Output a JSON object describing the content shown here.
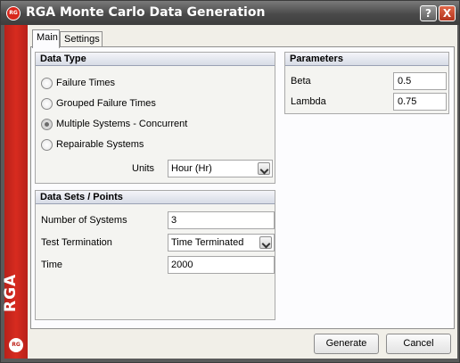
{
  "window": {
    "title": "RGA Monte Carlo Data Generation",
    "logo_text": "RG",
    "help_label": "?",
    "close_label": "X"
  },
  "sidebar": {
    "brand": "RGA",
    "logo_text": "RG"
  },
  "tabs": [
    {
      "label": "Main",
      "active": true
    },
    {
      "label": "Settings",
      "active": false
    }
  ],
  "data_type": {
    "header": "Data Type",
    "options": [
      {
        "label": "Failure Times",
        "checked": false
      },
      {
        "label": "Grouped Failure Times",
        "checked": false
      },
      {
        "label": "Multiple Systems - Concurrent",
        "checked": true
      },
      {
        "label": "Repairable Systems",
        "checked": false
      }
    ],
    "units_label": "Units",
    "units_value": "Hour (Hr)"
  },
  "data_sets": {
    "header": "Data Sets / Points",
    "systems_label": "Number of Systems",
    "systems_value": "3",
    "termination_label": "Test Termination",
    "termination_value": "Time Terminated",
    "time_label": "Time",
    "time_value": "2000"
  },
  "parameters": {
    "header": "Parameters",
    "beta_label": "Beta",
    "beta_value": "0.5",
    "lambda_label": "Lambda",
    "lambda_value": "0.75"
  },
  "buttons": {
    "generate": "Generate",
    "cancel": "Cancel"
  },
  "colors": {
    "sidebar": "#d72b1f",
    "client_bg": "#f1efe8",
    "group_header": "#d7dbe6"
  },
  "icons": {
    "app": "app-logo-icon",
    "help": "help-icon",
    "close": "close-icon"
  }
}
